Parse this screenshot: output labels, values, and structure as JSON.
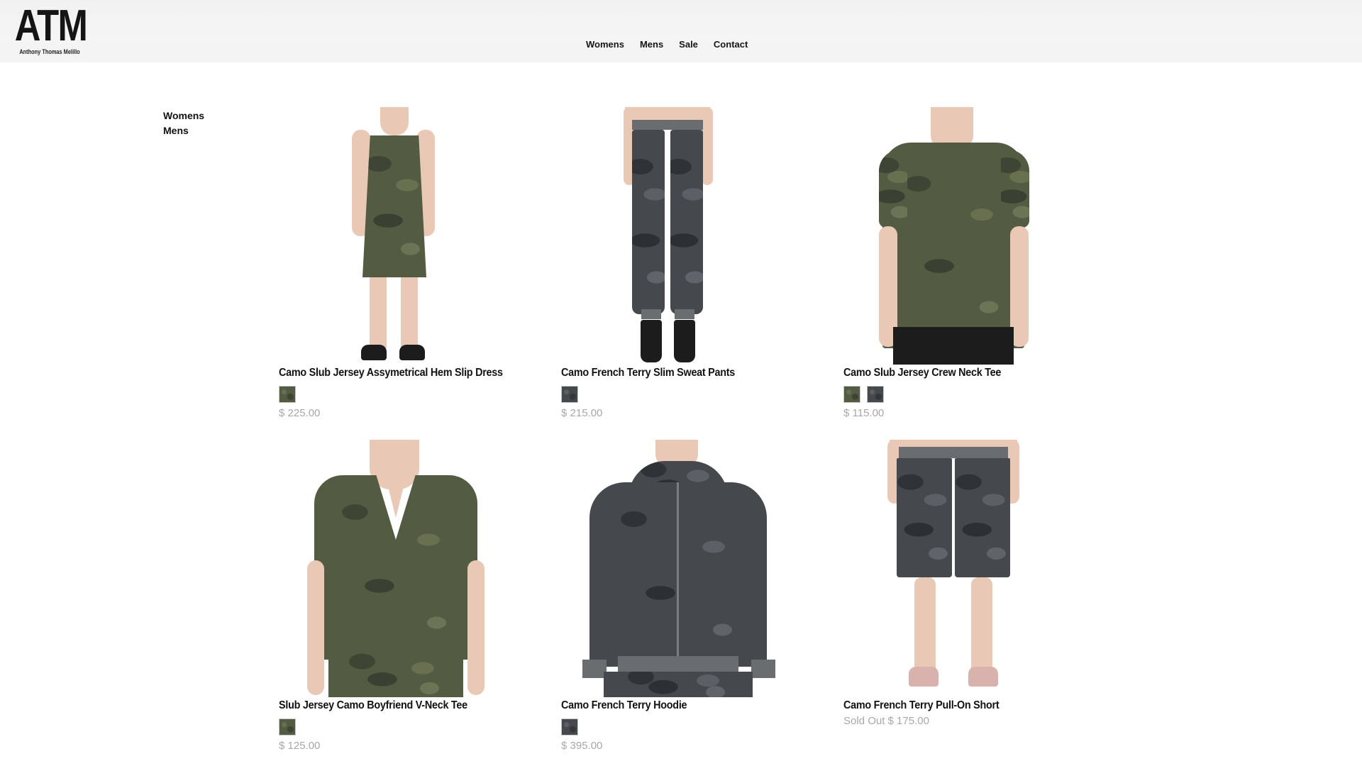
{
  "brand": {
    "logo": "ATM",
    "tagline": "Anthony Thomas Melillo"
  },
  "nav": [
    "Womens",
    "Mens",
    "Sale",
    "Contact"
  ],
  "sidebar": [
    "Womens",
    "Mens"
  ],
  "colors": {
    "olive_camo": "#535b42",
    "grey_camo": "#45494e",
    "price_text": "#a8a8a8"
  },
  "products": [
    {
      "name": "Camo Slub Jersey Assymetrical Hem Slip Dress",
      "price": "$ 225.00",
      "swatches": [
        "olive-camo"
      ]
    },
    {
      "name": "Camo French Terry Slim Sweat Pants",
      "price": "$ 215.00",
      "swatches": [
        "grey-camo"
      ]
    },
    {
      "name": "Camo Slub Jersey Crew Neck Tee",
      "price": "$ 115.00",
      "swatches": [
        "olive-camo",
        "grey-camo"
      ]
    },
    {
      "name": "Slub Jersey Camo Boyfriend V-Neck Tee",
      "price": "$ 125.00",
      "swatches": [
        "olive-camo"
      ]
    },
    {
      "name": "Camo French Terry Hoodie",
      "price": "$ 395.00",
      "swatches": [
        "grey-camo"
      ]
    },
    {
      "name": "Camo French Terry Pull-On Short",
      "status": "Sold Out",
      "price": "$ 175.00",
      "swatches": []
    }
  ]
}
